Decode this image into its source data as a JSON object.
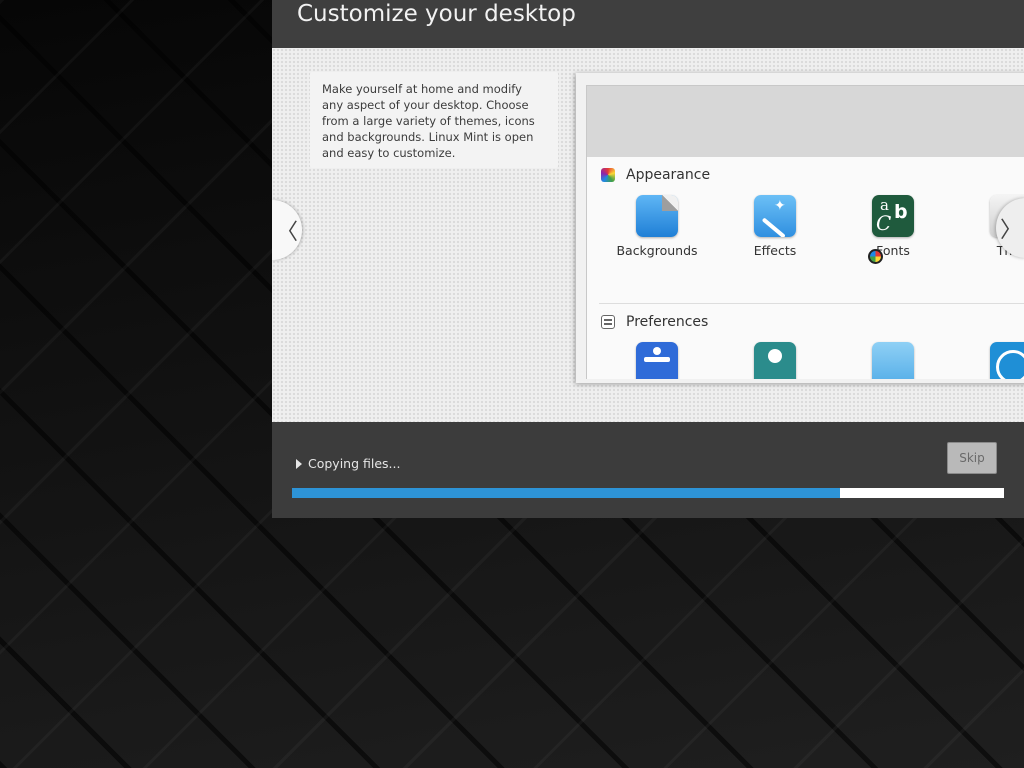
{
  "slide": {
    "title": "Customize your desktop",
    "description": "Make yourself at home and modify any aspect of your desktop. Choose from a large variety of themes, icons and backgrounds. Linux Mint is open and easy to customize.",
    "prev_icon": "〈",
    "next_icon": "〉"
  },
  "preview": {
    "appearance": {
      "title": "Appearance",
      "items": [
        {
          "label": "Backgrounds",
          "icon": "backgrounds-icon"
        },
        {
          "label": "Effects",
          "icon": "effects-icon"
        },
        {
          "label": "Fonts",
          "icon": "fonts-icon"
        },
        {
          "label": "Ther",
          "icon": "themes-icon"
        }
      ]
    },
    "preferences": {
      "title": "Preferences",
      "items": [
        {
          "icon": "accessibility-icon"
        },
        {
          "icon": "account-icon"
        },
        {
          "icon": "preferences-app-icon"
        },
        {
          "icon": "clock-icon"
        }
      ]
    }
  },
  "footer": {
    "status": "Copying files...",
    "skip_label": "Skip",
    "progress_percent": 77
  },
  "colors": {
    "accent": "#2d93d6",
    "panel": "#3c3c3c",
    "slide_bg": "#efefef"
  }
}
